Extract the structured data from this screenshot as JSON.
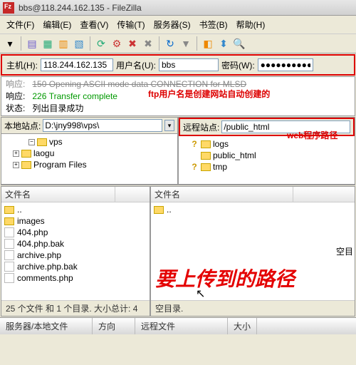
{
  "window": {
    "title": "bbs@118.244.162.135 - FileZilla"
  },
  "menu": {
    "file": "文件(F)",
    "edit": "编辑(E)",
    "view": "查看(V)",
    "transfer": "传输(T)",
    "server": "服务器(S)",
    "bookmarks": "书签(B)",
    "help": "帮助(H)"
  },
  "conn": {
    "host_label": "主机(H):",
    "host": "118.244.162.135",
    "user_label": "用户名(U):",
    "user": "bbs",
    "pass_label": "密码(W):",
    "pass": "●●●●●●●●●●"
  },
  "log": {
    "l1a": "响应:",
    "l1b": "150 Opening ASCII mode data CONNECTION for MLSD",
    "l2a": "响应:",
    "l2b": "226 Transfer complete",
    "l3a": "状态:",
    "l3b": "列出目录成功"
  },
  "anno": {
    "ftp_user": "ftp用户名是创建网站自动创建的",
    "web_path": "web程序路径",
    "upload_to": "要上传到的路径"
  },
  "local": {
    "label": "本地站点:",
    "path": "D:\\jny998\\vps\\",
    "tree": [
      "vps",
      "laogu",
      "Program Files"
    ],
    "header_col": "文件名",
    "files": [
      {
        "name": "..",
        "type": "up"
      },
      {
        "name": "images",
        "type": "dir"
      },
      {
        "name": "404.php",
        "type": "php"
      },
      {
        "name": "404.php.bak",
        "type": "bak"
      },
      {
        "name": "archive.php",
        "type": "php"
      },
      {
        "name": "archive.php.bak",
        "type": "bak"
      },
      {
        "name": "comments.php",
        "type": "php"
      }
    ],
    "status": "25 个文件 和 1 个目录. 大小总计: 4",
    "err_col": "空目"
  },
  "remote": {
    "label": "远程站点:",
    "path": "/public_html",
    "tree": [
      {
        "name": "logs",
        "q": true
      },
      {
        "name": "public_html",
        "q": false
      },
      {
        "name": "tmp",
        "q": true
      }
    ],
    "header_col": "文件名",
    "files": [
      {
        "name": "..",
        "type": "up"
      }
    ],
    "status": "空目录."
  },
  "bottom": {
    "t1": "服务器/本地文件",
    "t2": "方向",
    "t3": "远程文件",
    "t4": "大小"
  }
}
